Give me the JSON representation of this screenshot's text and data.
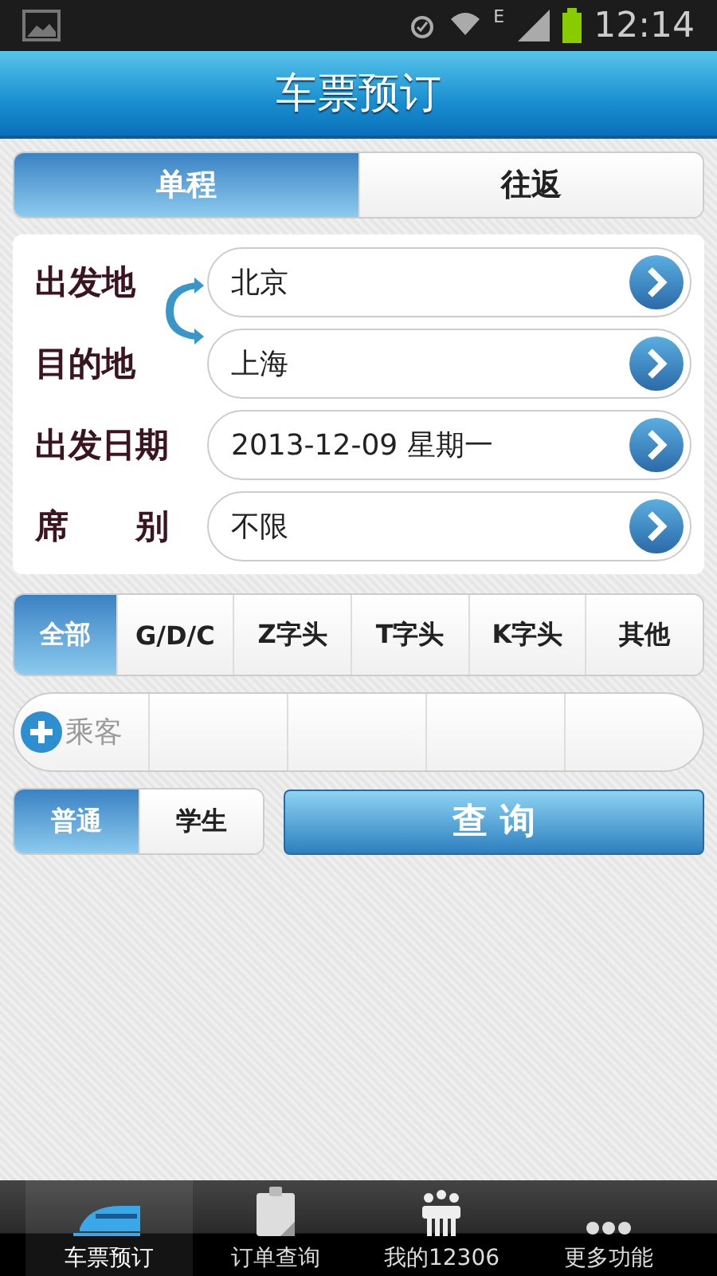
{
  "status_bar": {
    "network": "E",
    "time": "12:14"
  },
  "header": {
    "title": "车票预订"
  },
  "trip_tabs": [
    {
      "label": "单程",
      "selected": true
    },
    {
      "label": "往返",
      "selected": false
    }
  ],
  "form": {
    "rows": [
      {
        "label": "出发地",
        "value": "北京"
      },
      {
        "label": "目的地",
        "value": "上海"
      },
      {
        "label": "出发日期",
        "value": "2013-12-09 星期一"
      },
      {
        "label": "席　　别",
        "value": "不限"
      }
    ]
  },
  "train_types": [
    {
      "label": "全部",
      "selected": true
    },
    {
      "label": "G/D/C",
      "selected": false
    },
    {
      "label": "Z字头",
      "selected": false
    },
    {
      "label": "T字头",
      "selected": false
    },
    {
      "label": "K字头",
      "selected": false
    },
    {
      "label": "其他",
      "selected": false
    }
  ],
  "passengers": {
    "add_label": "乘客"
  },
  "ticket_types": [
    {
      "label": "普通",
      "selected": true
    },
    {
      "label": "学生",
      "selected": false
    }
  ],
  "search_button": "查 询",
  "bottom_nav": [
    {
      "label": "车票预订",
      "selected": true
    },
    {
      "label": "订单查询",
      "selected": false
    },
    {
      "label": "我的12306",
      "selected": false
    },
    {
      "label": "更多功能",
      "selected": false
    }
  ]
}
